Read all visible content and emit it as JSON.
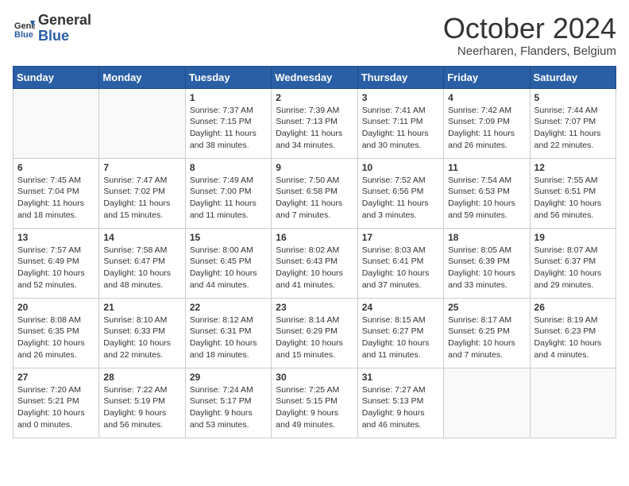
{
  "header": {
    "logo_line1": "General",
    "logo_line2": "Blue",
    "month": "October 2024",
    "location": "Neerharen, Flanders, Belgium"
  },
  "weekdays": [
    "Sunday",
    "Monday",
    "Tuesday",
    "Wednesday",
    "Thursday",
    "Friday",
    "Saturday"
  ],
  "weeks": [
    [
      {
        "day": "",
        "info": ""
      },
      {
        "day": "",
        "info": ""
      },
      {
        "day": "1",
        "info": "Sunrise: 7:37 AM\nSunset: 7:15 PM\nDaylight: 11 hours\nand 38 minutes."
      },
      {
        "day": "2",
        "info": "Sunrise: 7:39 AM\nSunset: 7:13 PM\nDaylight: 11 hours\nand 34 minutes."
      },
      {
        "day": "3",
        "info": "Sunrise: 7:41 AM\nSunset: 7:11 PM\nDaylight: 11 hours\nand 30 minutes."
      },
      {
        "day": "4",
        "info": "Sunrise: 7:42 AM\nSunset: 7:09 PM\nDaylight: 11 hours\nand 26 minutes."
      },
      {
        "day": "5",
        "info": "Sunrise: 7:44 AM\nSunset: 7:07 PM\nDaylight: 11 hours\nand 22 minutes."
      }
    ],
    [
      {
        "day": "6",
        "info": "Sunrise: 7:45 AM\nSunset: 7:04 PM\nDaylight: 11 hours\nand 18 minutes."
      },
      {
        "day": "7",
        "info": "Sunrise: 7:47 AM\nSunset: 7:02 PM\nDaylight: 11 hours\nand 15 minutes."
      },
      {
        "day": "8",
        "info": "Sunrise: 7:49 AM\nSunset: 7:00 PM\nDaylight: 11 hours\nand 11 minutes."
      },
      {
        "day": "9",
        "info": "Sunrise: 7:50 AM\nSunset: 6:58 PM\nDaylight: 11 hours\nand 7 minutes."
      },
      {
        "day": "10",
        "info": "Sunrise: 7:52 AM\nSunset: 6:56 PM\nDaylight: 11 hours\nand 3 minutes."
      },
      {
        "day": "11",
        "info": "Sunrise: 7:54 AM\nSunset: 6:53 PM\nDaylight: 10 hours\nand 59 minutes."
      },
      {
        "day": "12",
        "info": "Sunrise: 7:55 AM\nSunset: 6:51 PM\nDaylight: 10 hours\nand 56 minutes."
      }
    ],
    [
      {
        "day": "13",
        "info": "Sunrise: 7:57 AM\nSunset: 6:49 PM\nDaylight: 10 hours\nand 52 minutes."
      },
      {
        "day": "14",
        "info": "Sunrise: 7:58 AM\nSunset: 6:47 PM\nDaylight: 10 hours\nand 48 minutes."
      },
      {
        "day": "15",
        "info": "Sunrise: 8:00 AM\nSunset: 6:45 PM\nDaylight: 10 hours\nand 44 minutes."
      },
      {
        "day": "16",
        "info": "Sunrise: 8:02 AM\nSunset: 6:43 PM\nDaylight: 10 hours\nand 41 minutes."
      },
      {
        "day": "17",
        "info": "Sunrise: 8:03 AM\nSunset: 6:41 PM\nDaylight: 10 hours\nand 37 minutes."
      },
      {
        "day": "18",
        "info": "Sunrise: 8:05 AM\nSunset: 6:39 PM\nDaylight: 10 hours\nand 33 minutes."
      },
      {
        "day": "19",
        "info": "Sunrise: 8:07 AM\nSunset: 6:37 PM\nDaylight: 10 hours\nand 29 minutes."
      }
    ],
    [
      {
        "day": "20",
        "info": "Sunrise: 8:08 AM\nSunset: 6:35 PM\nDaylight: 10 hours\nand 26 minutes."
      },
      {
        "day": "21",
        "info": "Sunrise: 8:10 AM\nSunset: 6:33 PM\nDaylight: 10 hours\nand 22 minutes."
      },
      {
        "day": "22",
        "info": "Sunrise: 8:12 AM\nSunset: 6:31 PM\nDaylight: 10 hours\nand 18 minutes."
      },
      {
        "day": "23",
        "info": "Sunrise: 8:14 AM\nSunset: 6:29 PM\nDaylight: 10 hours\nand 15 minutes."
      },
      {
        "day": "24",
        "info": "Sunrise: 8:15 AM\nSunset: 6:27 PM\nDaylight: 10 hours\nand 11 minutes."
      },
      {
        "day": "25",
        "info": "Sunrise: 8:17 AM\nSunset: 6:25 PM\nDaylight: 10 hours\nand 7 minutes."
      },
      {
        "day": "26",
        "info": "Sunrise: 8:19 AM\nSunset: 6:23 PM\nDaylight: 10 hours\nand 4 minutes."
      }
    ],
    [
      {
        "day": "27",
        "info": "Sunrise: 7:20 AM\nSunset: 5:21 PM\nDaylight: 10 hours\nand 0 minutes."
      },
      {
        "day": "28",
        "info": "Sunrise: 7:22 AM\nSunset: 5:19 PM\nDaylight: 9 hours\nand 56 minutes."
      },
      {
        "day": "29",
        "info": "Sunrise: 7:24 AM\nSunset: 5:17 PM\nDaylight: 9 hours\nand 53 minutes."
      },
      {
        "day": "30",
        "info": "Sunrise: 7:25 AM\nSunset: 5:15 PM\nDaylight: 9 hours\nand 49 minutes."
      },
      {
        "day": "31",
        "info": "Sunrise: 7:27 AM\nSunset: 5:13 PM\nDaylight: 9 hours\nand 46 minutes."
      },
      {
        "day": "",
        "info": ""
      },
      {
        "day": "",
        "info": ""
      }
    ]
  ]
}
